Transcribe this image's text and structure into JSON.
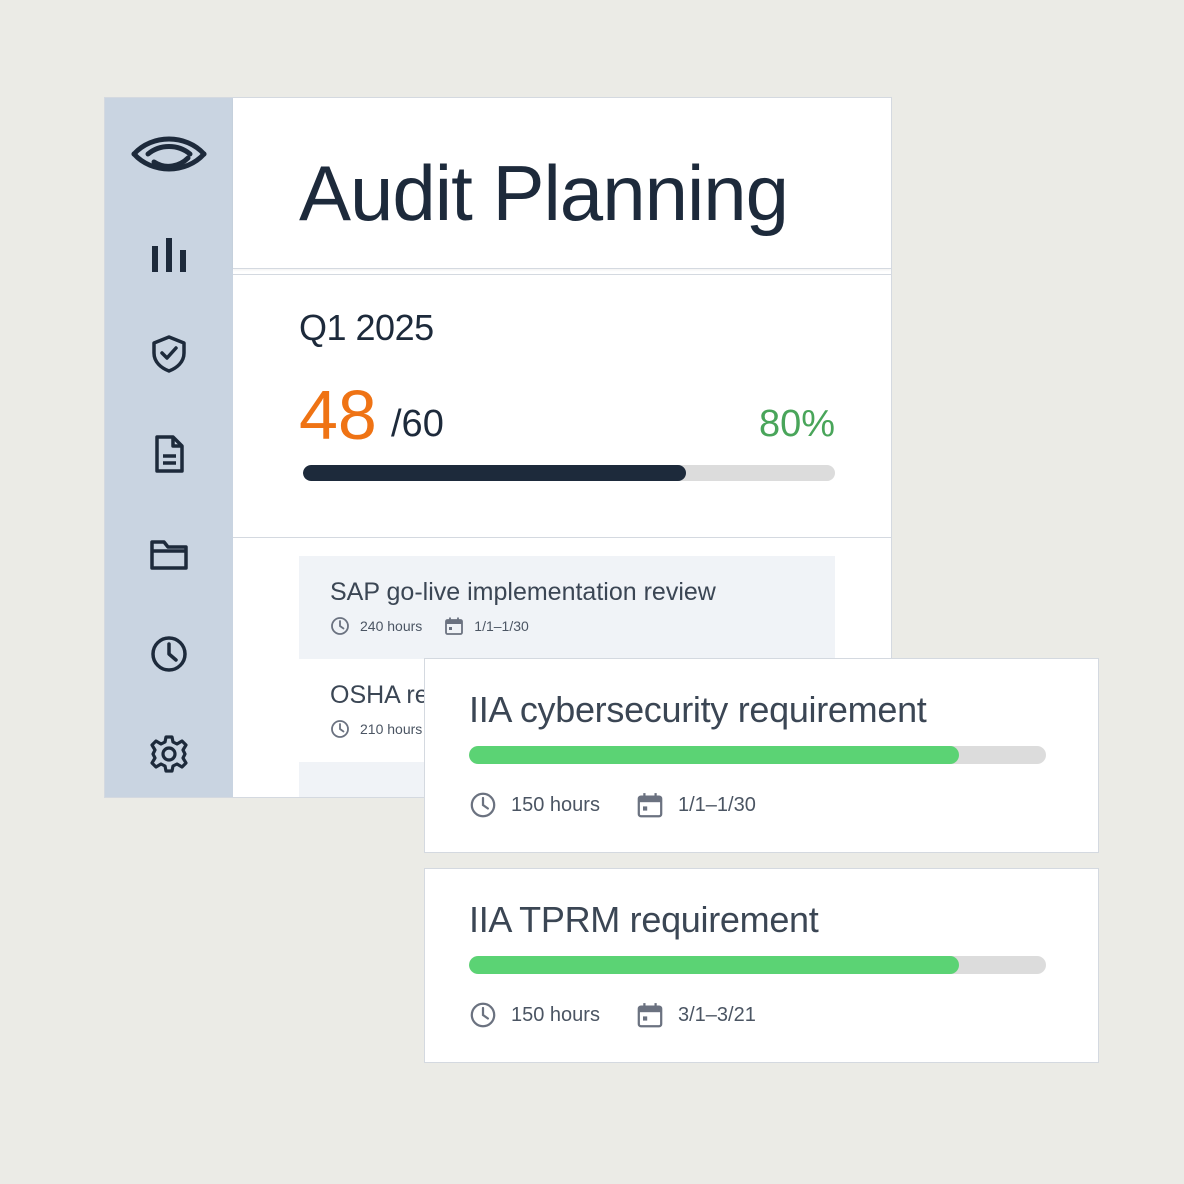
{
  "header": {
    "title": "Audit Planning"
  },
  "sidebar": {
    "items": [
      {
        "icon": "logo-icon"
      },
      {
        "icon": "bar-chart-icon"
      },
      {
        "icon": "shield-check-icon"
      },
      {
        "icon": "document-icon"
      },
      {
        "icon": "folder-icon"
      },
      {
        "icon": "clock-icon"
      },
      {
        "icon": "gear-icon"
      }
    ]
  },
  "summary": {
    "quarter": "Q1 2025",
    "completed": "48",
    "total": "/60",
    "percent": "80%",
    "progress": 0.72
  },
  "list": {
    "items": [
      {
        "title": "SAP go-live implementation review",
        "hours": "240 hours",
        "dates": "1/1–1/30"
      },
      {
        "title": "OSHA re",
        "hours": "210 hours",
        "dates": ""
      }
    ]
  },
  "cards": [
    {
      "title": "IIA cybersecurity requirement",
      "hours": "150 hours",
      "dates": "1/1–1/30",
      "progress": 0.85
    },
    {
      "title": "IIA TPRM requirement",
      "hours": "150 hours",
      "dates": "3/1–3/21",
      "progress": 0.85
    }
  ],
  "colors": {
    "sidebar_bg": "#c9d4e1",
    "accent_orange": "#ef7314",
    "accent_green": "#49a55a",
    "progress_dark": "#1d2a3b",
    "progress_green": "#5bd374"
  }
}
